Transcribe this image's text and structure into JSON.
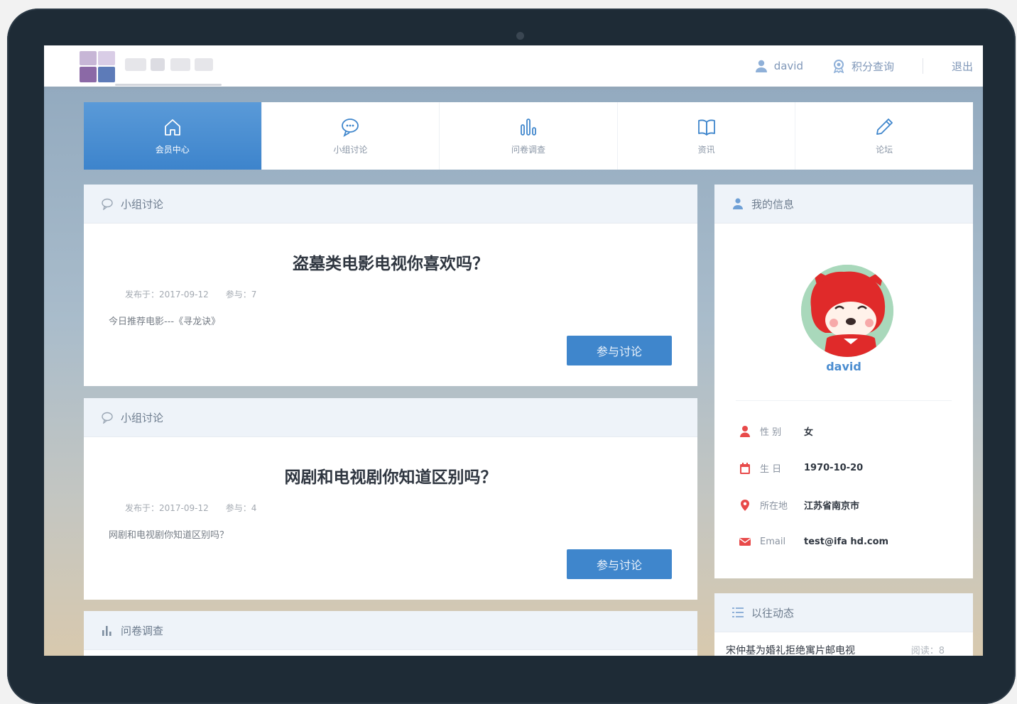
{
  "header": {
    "username": "david",
    "points_query": "积分查询",
    "logout": "退出"
  },
  "nav": [
    {
      "label": "会员中心",
      "icon": "home-icon",
      "active": true
    },
    {
      "label": "小组讨论",
      "icon": "chat-bubble-icon",
      "active": false
    },
    {
      "label": "问卷调查",
      "icon": "bar-chart-icon",
      "active": false
    },
    {
      "label": "资讯",
      "icon": "book-icon",
      "active": false
    },
    {
      "label": "论坛",
      "icon": "pencil-icon",
      "active": false
    }
  ],
  "discussions": [
    {
      "section": "小组讨论",
      "title": "盗墓类电影电视你喜欢吗？",
      "date": "发布于：2017-09-12",
      "participants": "参与：7",
      "excerpt": "今日推荐电影---《寻龙诀》",
      "button": "参与讨论"
    },
    {
      "section": "小组讨论",
      "title": "网剧和电视剧你知道区别吗？",
      "date": "发布于：2017-09-12",
      "participants": "参与：4",
      "excerpt": "网剧和电视剧你知道区别吗？",
      "button": "参与讨论"
    }
  ],
  "survey": {
    "section": "问卷调查"
  },
  "profile": {
    "section": "我的信息",
    "username": "david",
    "rows": [
      {
        "label": "性 别",
        "value": "女",
        "icon": "person-icon",
        "color": "#e84a4a"
      },
      {
        "label": "生 日",
        "value": "1970-10-20",
        "icon": "calendar-icon",
        "color": "#e84a4a"
      },
      {
        "label": "所在地",
        "value": "江苏省南京市",
        "icon": "location-pin-icon",
        "color": "#e84a4a"
      },
      {
        "label": "Email",
        "value": "test@ifa hd.com",
        "icon": "mail-icon",
        "color": "#e84a4a"
      }
    ]
  },
  "activity": {
    "section": "以往动态",
    "items": [
      {
        "text": "宋仲基为婚礼拒绝寓片邮电视",
        "count": "阅读：8"
      }
    ]
  },
  "colors": {
    "accent": "#3f86cc",
    "frame": "#1e2b36",
    "link": "#7f97b8"
  }
}
